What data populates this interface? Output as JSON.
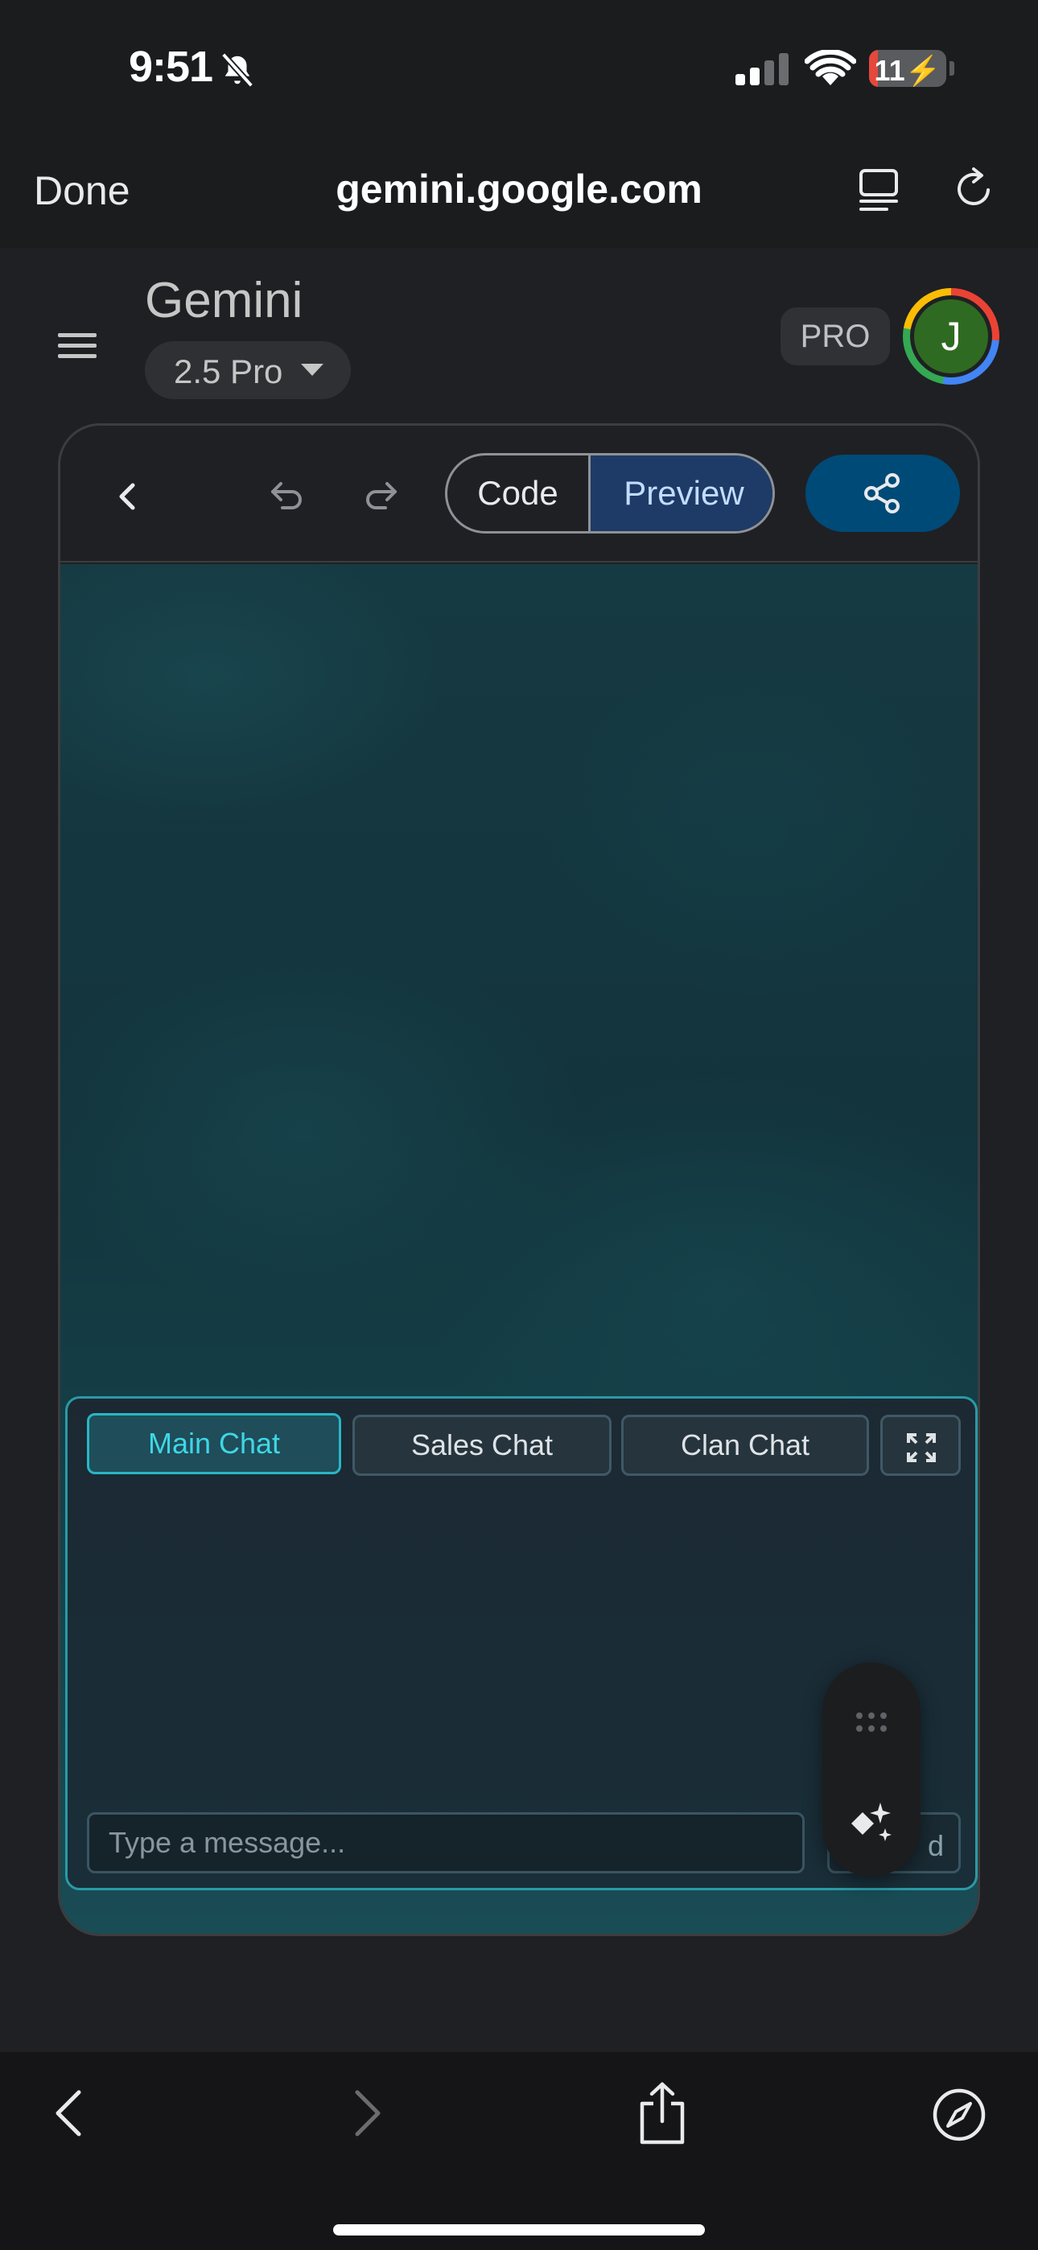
{
  "status_bar": {
    "time": "9:51",
    "battery_text": "11",
    "battery_level": 0.11,
    "icons": [
      "bell-slash-icon",
      "signal-icon",
      "wifi-icon",
      "battery-charging-icon"
    ]
  },
  "browser": {
    "done_label": "Done",
    "url": "gemini.google.com",
    "icons": [
      "reader-icon",
      "reload-icon"
    ]
  },
  "gemini": {
    "title": "Gemini",
    "model": "2.5 Pro",
    "pro_badge": "PRO",
    "avatar_initial": "J",
    "avatar_color": "#2f6a22"
  },
  "canvas": {
    "tabs": {
      "code": "Code",
      "preview": "Preview",
      "active": "Preview"
    },
    "share_color": "#004a77"
  },
  "chat": {
    "tabs": [
      {
        "label": "Main Chat",
        "active": true
      },
      {
        "label": "Sales Chat",
        "active": false
      },
      {
        "label": "Clan Chat",
        "active": false
      }
    ],
    "input_placeholder": "Type a message...",
    "send_label_partial": "d",
    "accent": "#2a9aa6"
  },
  "bottom_bar": {
    "icons": [
      "back-icon",
      "forward-icon",
      "share-icon",
      "compass-icon"
    ]
  }
}
